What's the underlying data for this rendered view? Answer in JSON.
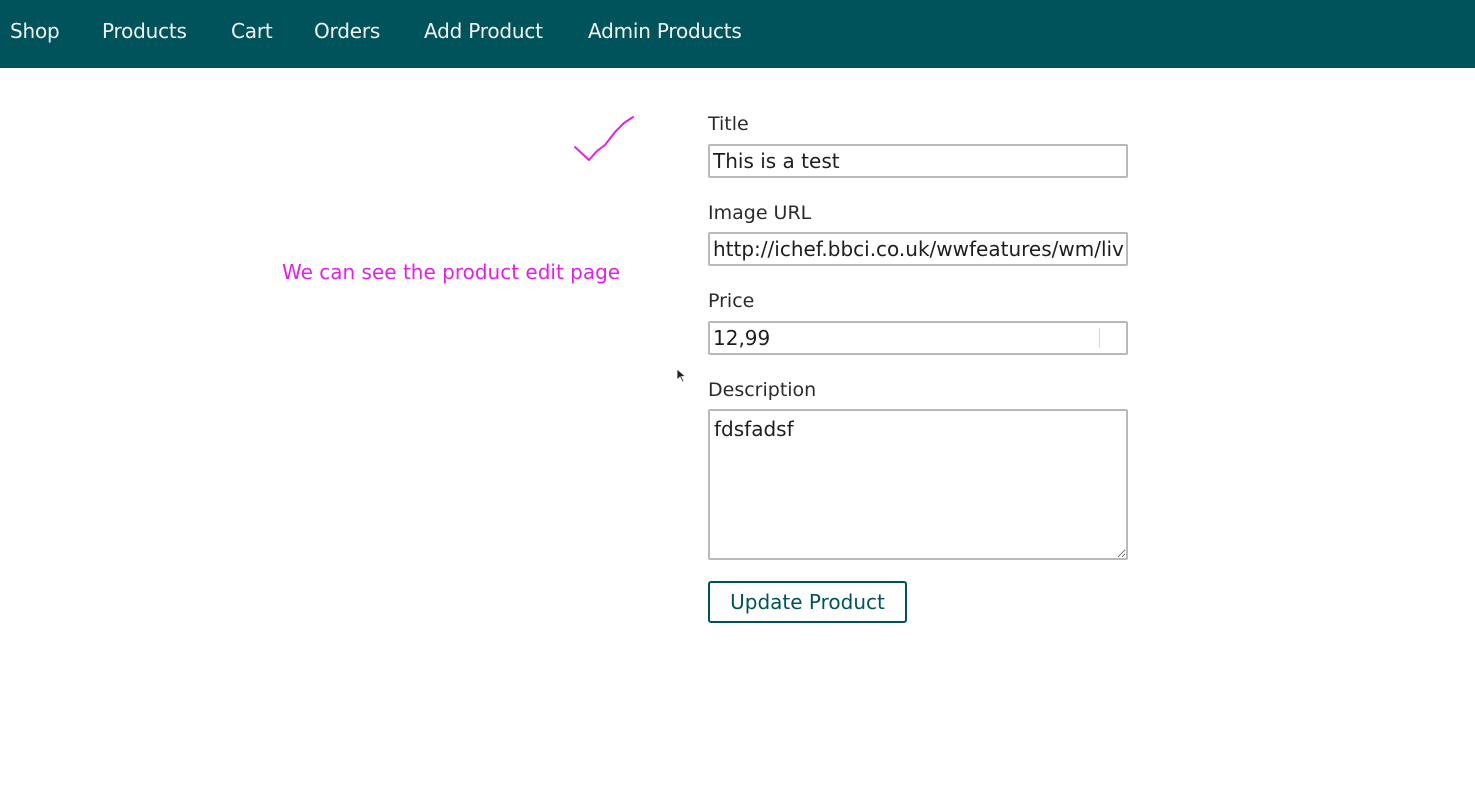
{
  "nav": {
    "items": [
      "Shop",
      "Products",
      "Cart",
      "Orders",
      "Add Product",
      "Admin Products"
    ]
  },
  "form": {
    "title_label": "Title",
    "title_value": "This is a test",
    "image_label": "Image URL",
    "image_value": "http://ichef.bbci.co.uk/wwfeatures/wm/live",
    "price_label": "Price",
    "price_value": "12,99",
    "description_label": "Description",
    "description_value": "fdsfadsf",
    "submit_label": "Update Product"
  },
  "annotation": {
    "text": "We can see the product edit page",
    "color": "#e41fe6"
  },
  "colors": {
    "brand": "#00535a",
    "annotation": "#e41fe6"
  },
  "icons": {
    "checkmark": "handwritten-checkmark-icon",
    "cursor": "mouse-cursor-icon"
  }
}
